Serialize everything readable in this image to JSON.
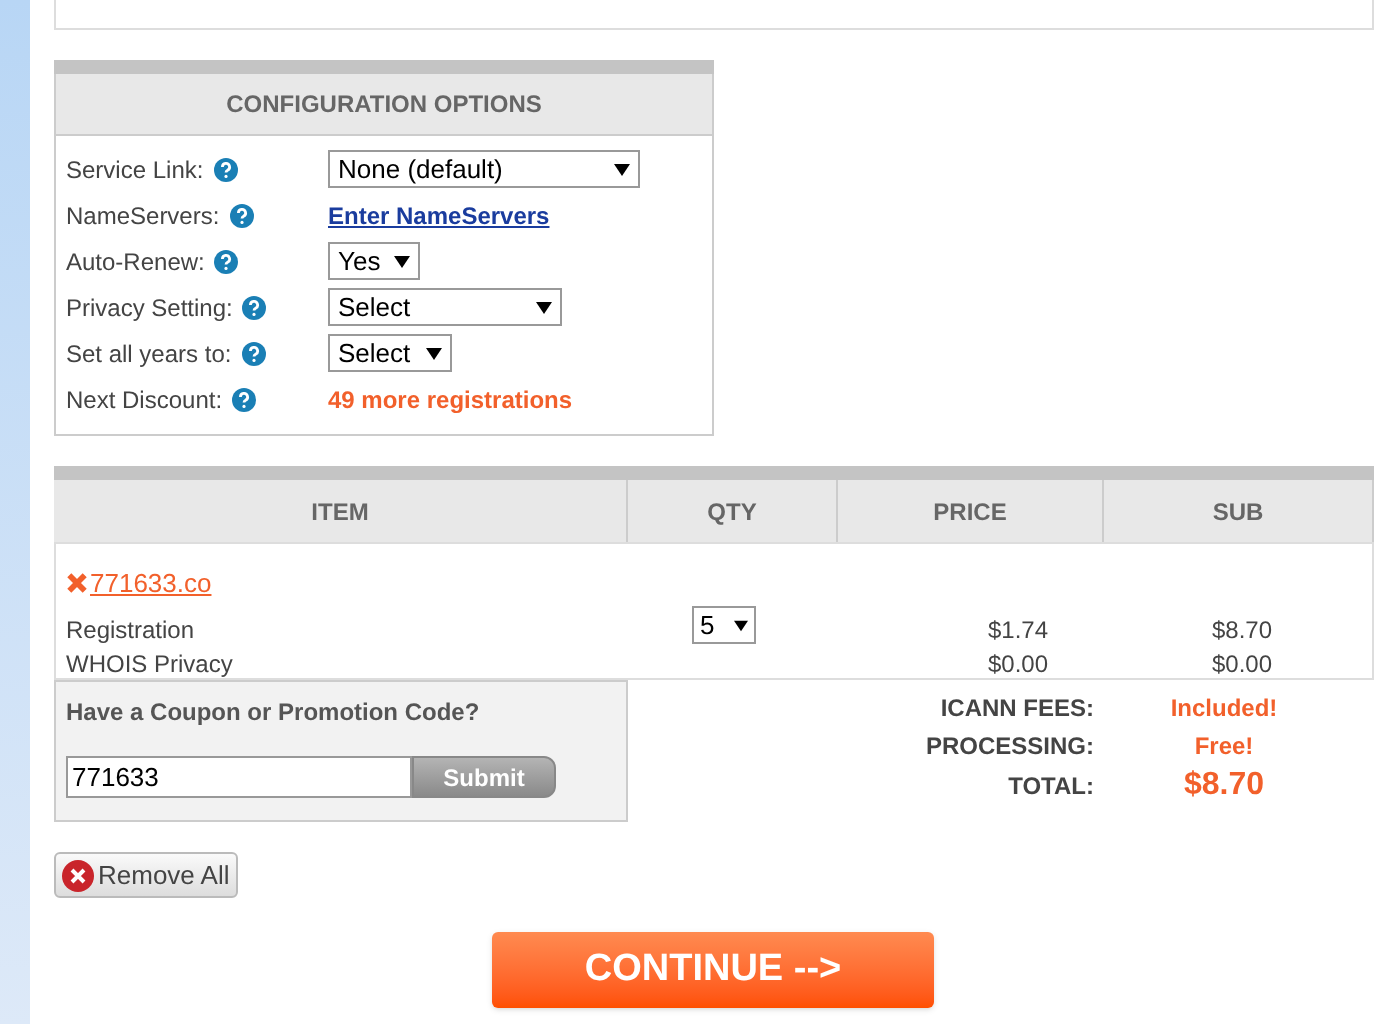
{
  "config": {
    "title": "CONFIGURATION OPTIONS",
    "rows": [
      {
        "label": "Service Link:",
        "kind": "select",
        "value": "None (default)"
      },
      {
        "label": "NameServers:",
        "kind": "link",
        "value": "Enter NameServers"
      },
      {
        "label": "Auto-Renew:",
        "kind": "select",
        "value": "Yes"
      },
      {
        "label": "Privacy Setting:",
        "kind": "select",
        "value": "Select"
      },
      {
        "label": "Set all years to:",
        "kind": "select",
        "value": "Select"
      },
      {
        "label": "Next Discount:",
        "kind": "note",
        "value": "49 more registrations"
      }
    ]
  },
  "cart": {
    "columns": [
      "ITEM",
      "QTY",
      "PRICE",
      "SUB"
    ],
    "domain": "771633.co",
    "qty": "5",
    "lines": [
      {
        "name": "Registration",
        "price": "$1.74",
        "sub": "$8.70"
      },
      {
        "name": "WHOIS Privacy",
        "price": "$0.00",
        "sub": "$0.00"
      }
    ]
  },
  "coupon": {
    "title": "Have a Coupon or Promotion Code?",
    "value": "771633",
    "button": "Submit"
  },
  "totals": [
    {
      "label": "ICANN FEES:",
      "value": "Included!",
      "kind": "normal"
    },
    {
      "label": "PROCESSING:",
      "value": "Free!",
      "kind": "normal"
    },
    {
      "label": "TOTAL:",
      "value": "$8.70",
      "kind": "total"
    }
  ],
  "remove_all": "Remove All",
  "continue": "CONTINUE -->"
}
